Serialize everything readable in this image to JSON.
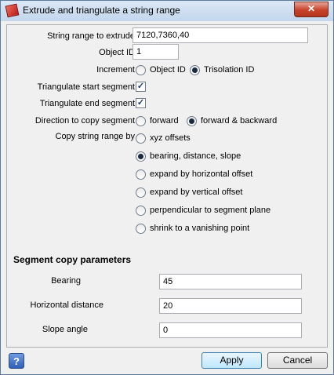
{
  "window": {
    "title": "Extrude and triangulate a string range",
    "close_label": "✕"
  },
  "form": {
    "string_range_label": "String range to extrude",
    "string_range_value": "7120,7360,40",
    "object_id_label": "Object ID",
    "object_id_value": "1",
    "increment_label": "Increment",
    "increment_options": [
      "Object ID",
      "Trisolation ID"
    ],
    "increment_selected": "Trisolation ID",
    "tri_start_label": "Triangulate start segment",
    "tri_start_checked": true,
    "tri_end_label": "Triangulate end segment",
    "tri_end_checked": true,
    "direction_label": "Direction to copy segment",
    "direction_options": [
      "forward",
      "forward & backward"
    ],
    "direction_selected": "forward & backward",
    "copy_by_label": "Copy string range by",
    "copy_by_options": [
      "xyz offsets",
      "bearing, distance, slope",
      "expand by horizontal offset",
      "expand by vertical offset",
      "perpendicular to segment plane",
      "shrink to a vanishing point"
    ],
    "copy_by_selected": "bearing, distance, slope"
  },
  "segment": {
    "title": "Segment copy parameters",
    "bearing_label": "Bearing",
    "bearing_value": "45",
    "hdist_label": "Horizontal distance",
    "hdist_value": "20",
    "slope_label": "Slope angle",
    "slope_value": "0"
  },
  "footer": {
    "help_label": "?",
    "apply_label": "Apply",
    "cancel_label": "Cancel"
  }
}
